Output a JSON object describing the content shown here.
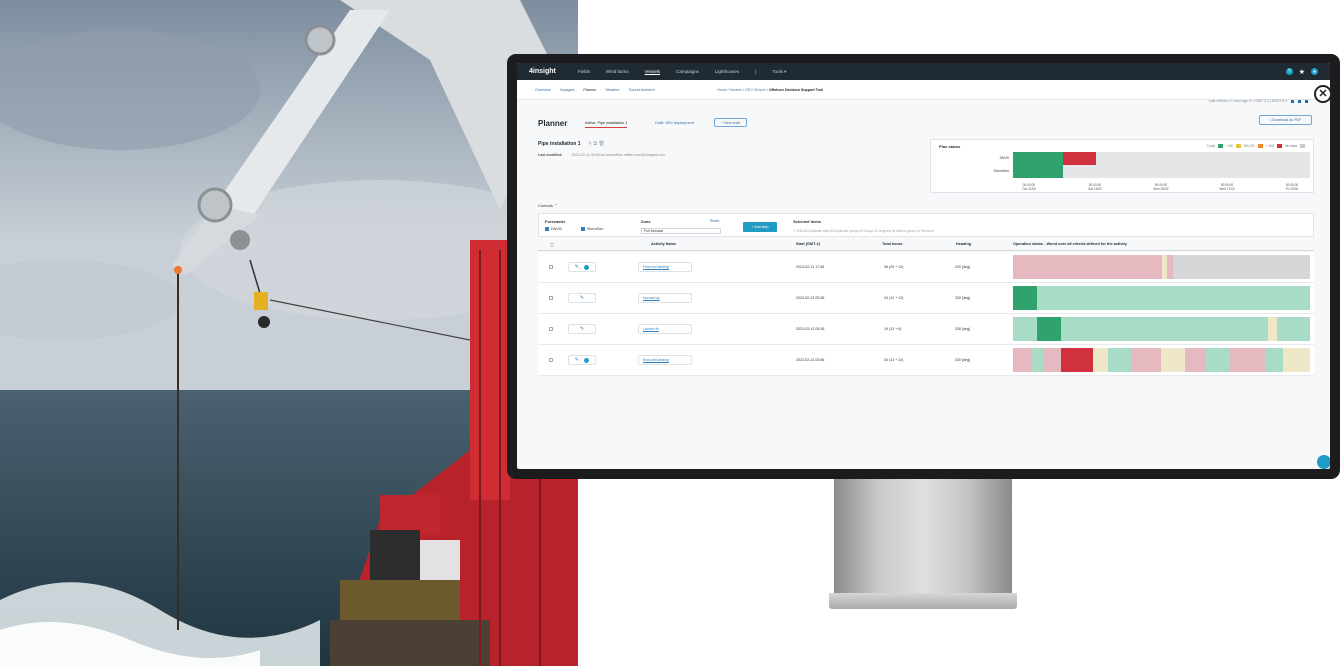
{
  "app": {
    "logo": "4insight",
    "top_nav": [
      "Fields",
      "Wind farms",
      "Vessels",
      "Campaigns",
      "Lighthouses",
      "|",
      "Tools ▾"
    ],
    "active_top_nav": "Vessels"
  },
  "sub_nav": {
    "items": [
      "Overview",
      "Voyages",
      "Planner",
      "Weather",
      "Sound Ambient"
    ],
    "active": "Planner",
    "breadcrumb": [
      "Home",
      "Vessels",
      "GEO Sleipnir"
    ],
    "breadcrumb_current": "Offshore Decision Support Tool",
    "right_info": "Last refresh • 1 hour ago  ⟳  |  GMT 2.3  |  KNOTS ▾"
  },
  "planner": {
    "title": "Planner",
    "tabs": [
      "Active: Pipe installation 1",
      "Draft: SRV deployment"
    ],
    "new_draft_label": "+ New draft",
    "download_label": "⤓ Download as PDF",
    "plan_name": "Pipe installation 1",
    "last_modified_label": "Last modified:",
    "last_modified_value": "2023-02-11 09:48 by someoffice.offsite.user@4insight.com"
  },
  "plan_status": {
    "title": "Plan status",
    "legend": [
      "0 (ok)",
      "< 50",
      "50-100",
      "> 100",
      "No data"
    ],
    "legend_colors": [
      "#2fa36b",
      "#e8c43a",
      "#f08a24",
      "#d0313d",
      "#c7c9cb"
    ],
    "rows": [
      "DNVS",
      "StormGeo"
    ],
    "ticks": [
      "00:00:00\nThu 11/02",
      "00:00:00\nSat 13/02",
      "00:00:00\nMon 15/02",
      "00:00:00\nWed 17/02",
      "00:00:00\nFri 19/02"
    ],
    "row_segments": [
      [
        [
          "#2fa36b",
          0.17
        ],
        [
          "#d0313d",
          0.11
        ],
        [
          "#e4e6e8",
          0.72
        ]
      ],
      [
        [
          "#2fa36b",
          0.17
        ],
        [
          "#e4e6e8",
          0.83
        ]
      ]
    ]
  },
  "controls": {
    "heading": "Controls ⌃",
    "forecaster_label": "Forecaster",
    "forecaster_options": [
      "DNV.B",
      "StormGeo"
    ],
    "zone_label": "Zone",
    "zone_reset": "Reset",
    "zone_value": "Full forecast",
    "add_step_label": "+ Add step",
    "selected_items_label": "Selected items",
    "selected_tools": "✎ Edit   ⧉ Duplicate step   ⧉ Duplicate group   ⊞ Group   ⊟ Ungroup   ⊕ Add to group   ⊘ Remove"
  },
  "table": {
    "headers": [
      "Activity Name",
      "Start [GMT-2]",
      "Total hours",
      "Heading",
      "Operation status - Worst over all criteria defined for the activity"
    ],
    "rows": [
      {
        "name": "First end landing",
        "start": "2023-02-11 17:36",
        "hours": "36 (29 + 12)",
        "heading": "220 [deg]",
        "segments": [
          [
            "#e6b8c0",
            0.5
          ],
          [
            "#efe8c8",
            0.02
          ],
          [
            "#e6b8c0",
            0.02
          ],
          [
            "#d4d6d8",
            0.46
          ]
        ]
      },
      {
        "name": "Normal lay",
        "start": "2023-02-13 05:36",
        "hours": "34 (12 + 12)",
        "heading": "330 [deg]",
        "segments": [
          [
            "#2fa36b",
            0.08
          ],
          [
            "#a9dcc7",
            0.92
          ]
        ]
      },
      {
        "name": "Launch fix",
        "start": "2023-02-13 05:36",
        "hours": "19 (13 + 6)",
        "heading": "330 [deg]",
        "segments": [
          [
            "#a9dcc7",
            0.08
          ],
          [
            "#2fa36b",
            0.08
          ],
          [
            "#a9dcc7",
            0.7
          ],
          [
            "#efe8c8",
            0.03
          ],
          [
            "#a9dcc7",
            0.11
          ]
        ]
      },
      {
        "name": "End until landing",
        "start": "2023-02-13 03:56",
        "hours": "34 (13 + 12)",
        "heading": "330 [deg]",
        "segments": [
          [
            "#e6b8c0",
            0.06
          ],
          [
            "#a9dcc7",
            0.04
          ],
          [
            "#e6b8c0",
            0.06
          ],
          [
            "#d0313d",
            0.11
          ],
          [
            "#efe8c8",
            0.05
          ],
          [
            "#a9dcc7",
            0.08
          ],
          [
            "#e6b8c0",
            0.1
          ],
          [
            "#efe8c8",
            0.08
          ],
          [
            "#e6b8c0",
            0.07
          ],
          [
            "#a9dcc7",
            0.08
          ],
          [
            "#e6b8c0",
            0.12
          ],
          [
            "#a9dcc7",
            0.06
          ],
          [
            "#efe8c8",
            0.09
          ]
        ]
      }
    ]
  },
  "colors": {
    "brand": "#1f9bc4",
    "topbar": "#1f2a33",
    "link": "#3a6c9e"
  }
}
